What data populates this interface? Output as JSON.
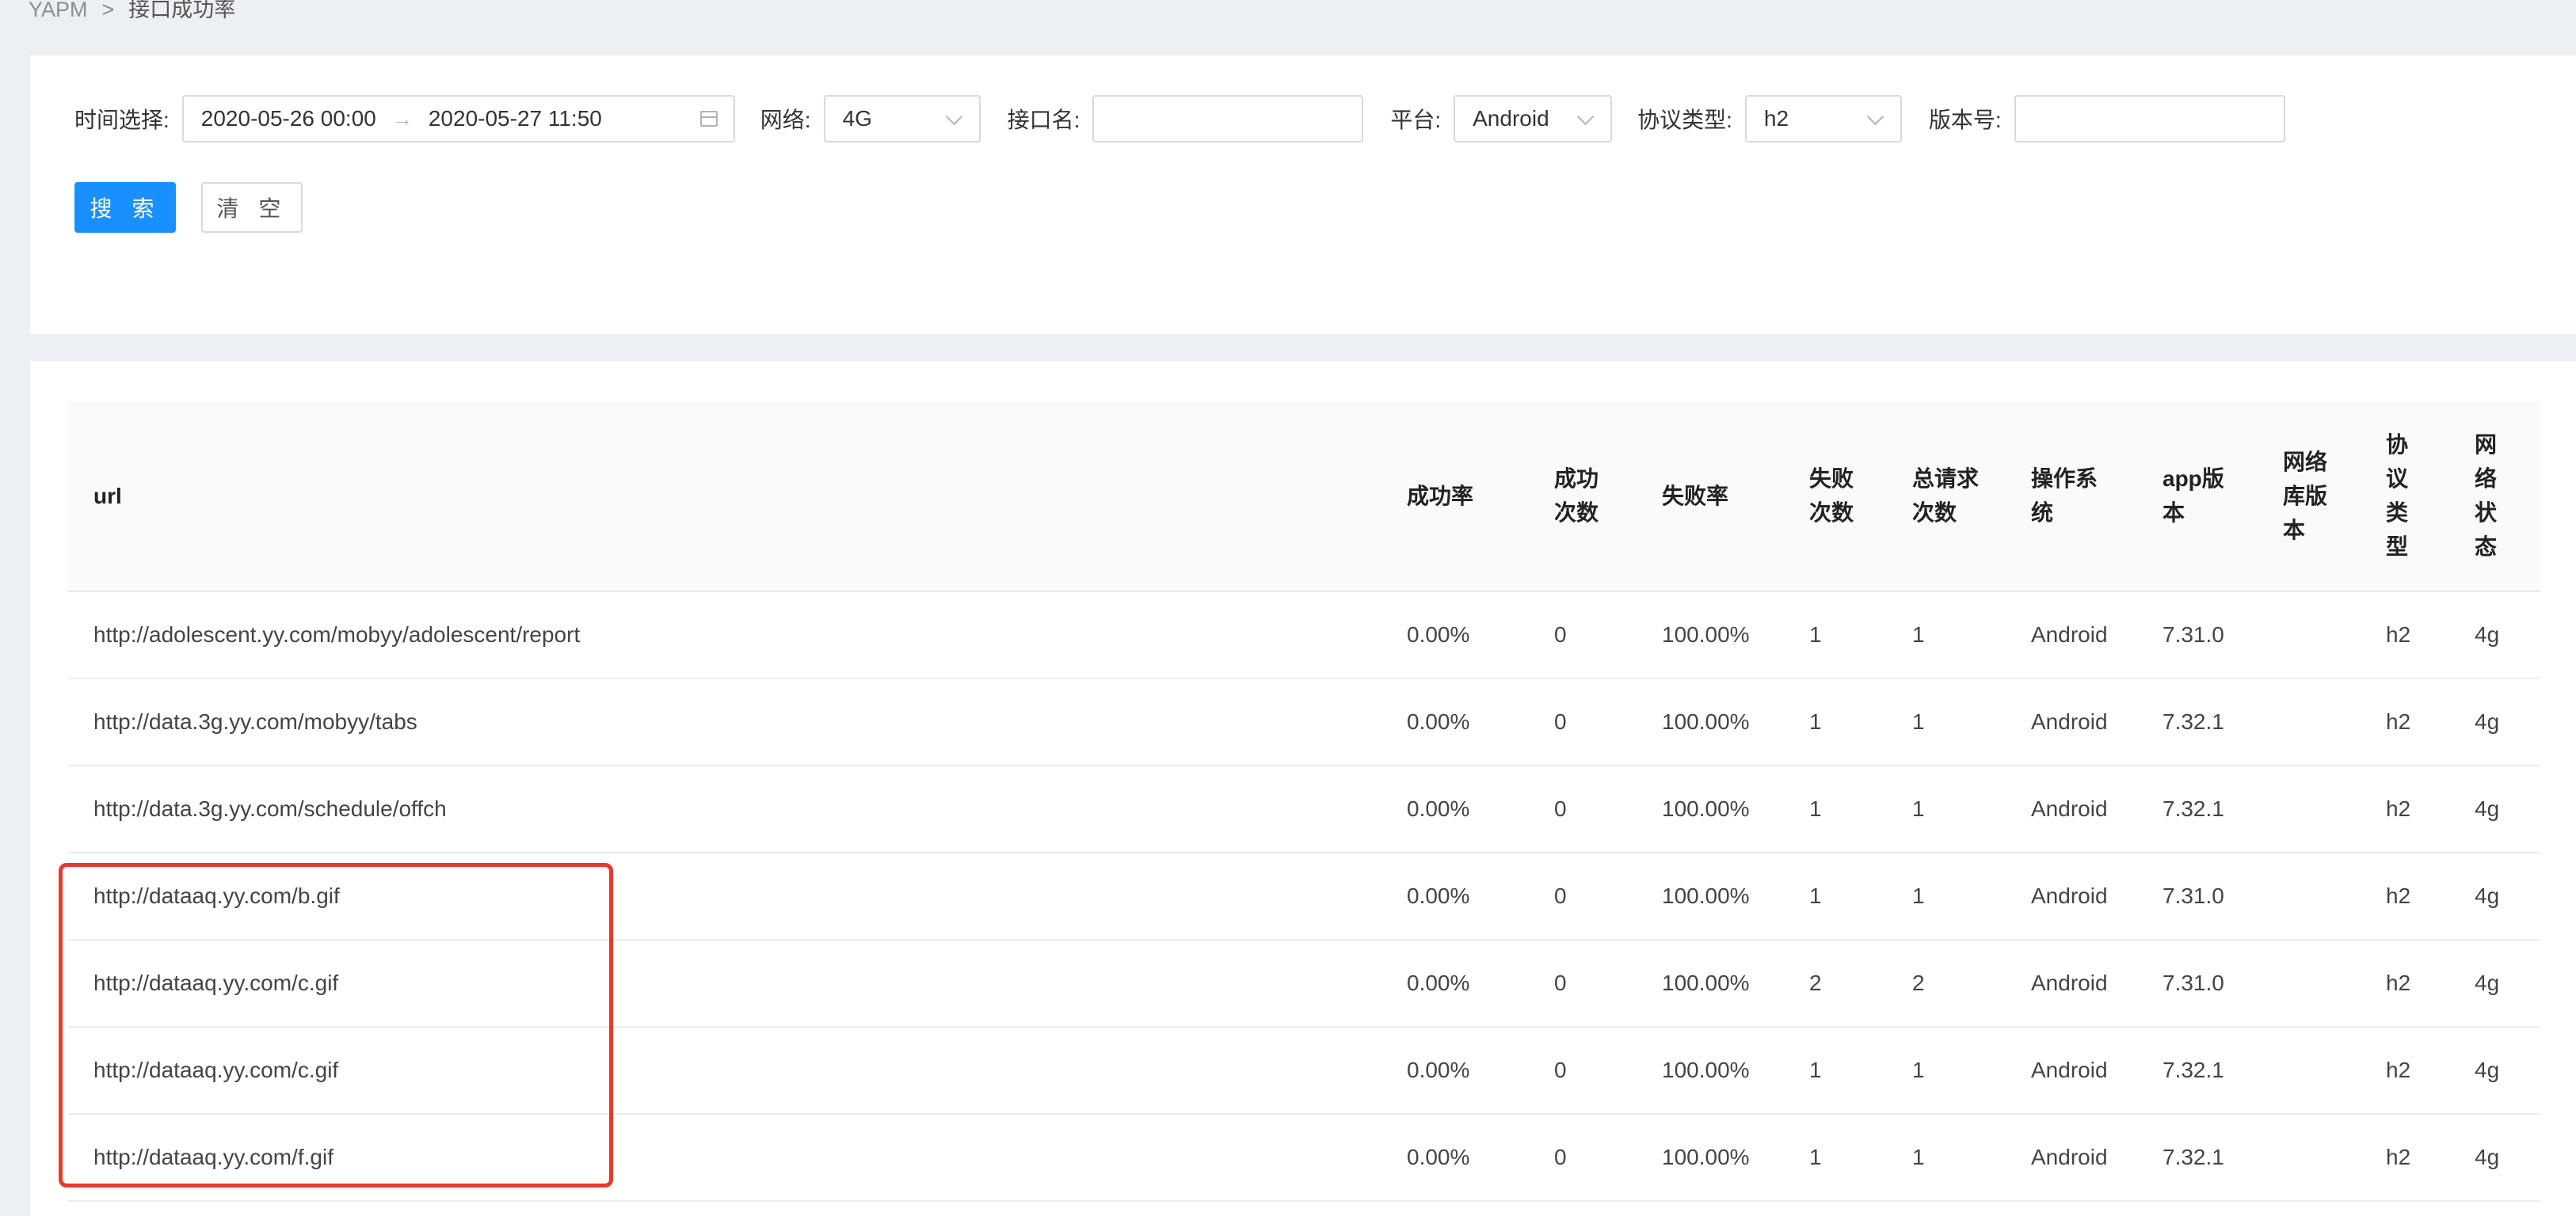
{
  "breadcrumb": {
    "root": "YAPM",
    "separator": ">",
    "current": "接口成功率"
  },
  "filters": {
    "time": {
      "label": "时间选择:",
      "start": "2020-05-26 00:00",
      "end": "2020-05-27 11:50"
    },
    "network": {
      "label": "网络:",
      "value": "4G"
    },
    "api_name": {
      "label": "接口名:",
      "value": ""
    },
    "platform": {
      "label": "平台:",
      "value": "Android"
    },
    "protocol": {
      "label": "协议类型:",
      "value": "h2"
    },
    "version": {
      "label": "版本号:",
      "value": ""
    }
  },
  "buttons": {
    "search": "搜 索",
    "clear": "清 空"
  },
  "table": {
    "columns": [
      "url",
      "成功率",
      "成功\n次数",
      "失败率",
      "失败\n次数",
      "总请求\n次数",
      "操作系\n统",
      "app版\n本",
      "网络\n库版\n本",
      "协\n议\n类\n型",
      "网\n络\n状\n态"
    ],
    "rows": [
      [
        "http://adolescent.yy.com/mobyy/adolescent/report",
        "0.00%",
        "0",
        "100.00%",
        "1",
        "1",
        "Android",
        "7.31.0",
        "",
        "h2",
        "4g"
      ],
      [
        "http://data.3g.yy.com/mobyy/tabs",
        "0.00%",
        "0",
        "100.00%",
        "1",
        "1",
        "Android",
        "7.32.1",
        "",
        "h2",
        "4g"
      ],
      [
        "http://data.3g.yy.com/schedule/offch",
        "0.00%",
        "0",
        "100.00%",
        "1",
        "1",
        "Android",
        "7.32.1",
        "",
        "h2",
        "4g"
      ],
      [
        "http://dataaq.yy.com/b.gif",
        "0.00%",
        "0",
        "100.00%",
        "1",
        "1",
        "Android",
        "7.31.0",
        "",
        "h2",
        "4g"
      ],
      [
        "http://dataaq.yy.com/c.gif",
        "0.00%",
        "0",
        "100.00%",
        "2",
        "2",
        "Android",
        "7.31.0",
        "",
        "h2",
        "4g"
      ],
      [
        "http://dataaq.yy.com/c.gif",
        "0.00%",
        "0",
        "100.00%",
        "1",
        "1",
        "Android",
        "7.32.1",
        "",
        "h2",
        "4g"
      ],
      [
        "http://dataaq.yy.com/f.gif",
        "0.00%",
        "0",
        "100.00%",
        "1",
        "1",
        "Android",
        "7.32.1",
        "",
        "h2",
        "4g"
      ]
    ]
  },
  "colors": {
    "primary": "#1890ff",
    "highlight": "#e8392c"
  }
}
